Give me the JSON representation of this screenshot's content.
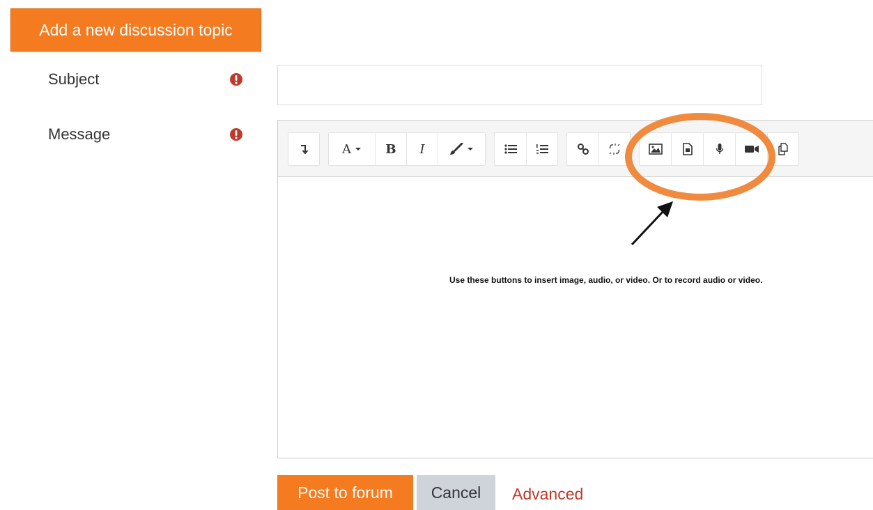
{
  "header": {
    "add_topic_label": "Add a new discussion topic"
  },
  "form": {
    "subject_label": "Subject",
    "message_label": "Message",
    "subject_value": "",
    "message_value": ""
  },
  "toolbar": {
    "buttons": [
      "collapse-icon",
      "font-style-icon",
      "bold-icon",
      "italic-icon",
      "text-color-icon",
      "unordered-list-icon",
      "ordered-list-icon",
      "link-icon",
      "unlink-icon",
      "insert-image-icon",
      "insert-media-icon",
      "record-audio-icon",
      "record-video-icon",
      "manage-files-icon"
    ],
    "font_glyph": "A",
    "bold_glyph": "B",
    "italic_glyph": "I"
  },
  "annotation": {
    "help_text": "Use these buttons to insert image, audio, or video. Or to record audio or video.",
    "highlight_color": "#f08a3e"
  },
  "footer": {
    "post_label": "Post to forum",
    "cancel_label": "Cancel",
    "advanced_label": "Advanced"
  },
  "colors": {
    "accent": "#f47b20",
    "required": "#c0392b",
    "link": "#c0392b"
  }
}
